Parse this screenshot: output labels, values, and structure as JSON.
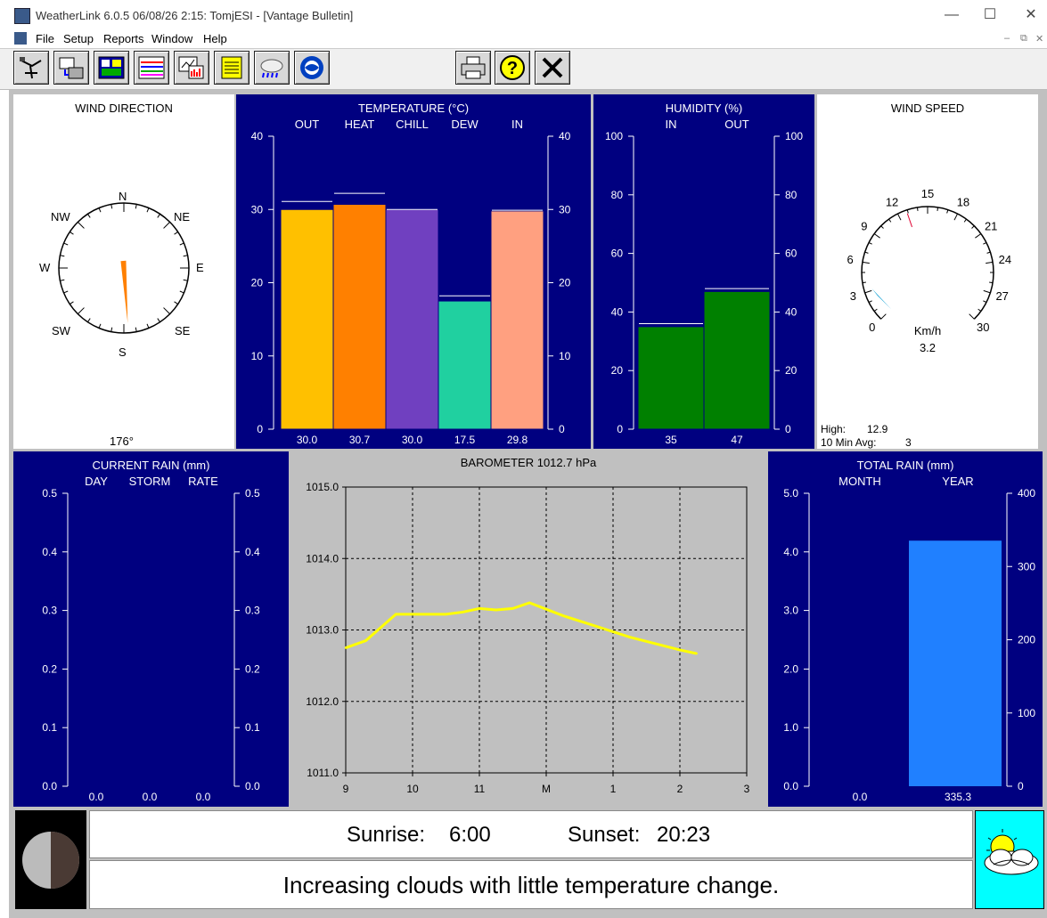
{
  "window": {
    "title": "WeatherLink 6.0.5  06/08/26   2:15: TomjESI - [Vantage Bulletin]",
    "controls": {
      "minimize": "—",
      "maximize": "☐",
      "close": "✕"
    }
  },
  "menu": {
    "items": [
      "File",
      "Setup",
      "Reports",
      "Window",
      "Help"
    ],
    "mdi_controls": [
      "–",
      "⧉",
      "✕"
    ]
  },
  "toolbar": {
    "buttons": [
      "station-icon",
      "download-icon",
      "bulletin-icon",
      "strip-chart-icon",
      "summary-icon",
      "notepad-icon",
      "weather-icon",
      "noaa-icon",
      "print-icon",
      "help-icon",
      "close-icon"
    ]
  },
  "wind_direction": {
    "title": "WIND DIRECTION",
    "labels": {
      "N": "N",
      "NE": "NE",
      "E": "E",
      "SE": "SE",
      "S": "S",
      "SW": "SW",
      "W": "W",
      "NW": "NW"
    },
    "direction_deg": 176,
    "value": "176°"
  },
  "temperature": {
    "title": "TEMPERATURE  (°C)",
    "columns": [
      "OUT",
      "HEAT",
      "CHILL",
      "DEW",
      "IN"
    ],
    "axis_ticks": [
      "40",
      "30",
      "20",
      "10",
      "0"
    ],
    "values": [
      "30.0",
      "30.7",
      "30.0",
      "17.5",
      "29.8"
    ],
    "colors": [
      "#ffc000",
      "#ff8000",
      "#7040c0",
      "#20d0a0",
      "#ffa080"
    ]
  },
  "humidity": {
    "title": "HUMIDITY  (%)",
    "columns": [
      "IN",
      "OUT"
    ],
    "axis_ticks": [
      "100",
      "80",
      "60",
      "40",
      "20",
      "0"
    ],
    "values": [
      "35",
      "47"
    ],
    "color": "#008000"
  },
  "wind_speed": {
    "title": "WIND SPEED",
    "ticks": [
      "0",
      "3",
      "6",
      "9",
      "12",
      "15",
      "18",
      "21",
      "24",
      "27",
      "30"
    ],
    "unit": "Km/h",
    "value": "3.2",
    "speed": 3.2,
    "high_label": "High:",
    "high_value": "12.9",
    "avg_label": "10 Min Avg:",
    "avg_value": "3"
  },
  "current_rain": {
    "title": "CURRENT RAIN  (mm)",
    "columns": [
      "DAY",
      "STORM",
      "RATE"
    ],
    "axis_ticks": [
      "0.5",
      "0.4",
      "0.3",
      "0.2",
      "0.1",
      "0.0"
    ],
    "values": [
      "0.0",
      "0.0",
      "0.0"
    ]
  },
  "barometer": {
    "title": "BAROMETER 1012.7 hPa",
    "y_ticks": [
      "1015.0",
      "1014.0",
      "1013.0",
      "1012.0",
      "1011.0"
    ],
    "x_ticks": [
      "9",
      "10",
      "11",
      "M",
      "1",
      "2",
      "3"
    ],
    "line_color": "#ffff00"
  },
  "chart_data": {
    "type": "line",
    "title": "BAROMETER 1012.7 hPa",
    "xlabel": "",
    "ylabel": "",
    "x": [
      9.0,
      9.3,
      9.75,
      10.0,
      10.5,
      10.75,
      11.0,
      11.25,
      11.5,
      11.75,
      12.25,
      12.75,
      13.25,
      14.0,
      14.25
    ],
    "series": [
      {
        "values": [
          1012.75,
          1012.85,
          1013.22,
          1013.22,
          1013.22,
          1013.25,
          1013.3,
          1013.28,
          1013.3,
          1013.38,
          1013.2,
          1013.05,
          1012.9,
          1012.72,
          1012.67
        ]
      }
    ],
    "xlim": [
      9,
      15
    ],
    "ylim": [
      1011.0,
      1015.0
    ],
    "grid": true
  },
  "total_rain": {
    "title": "TOTAL RAIN  (mm)",
    "columns": [
      "MONTH",
      "YEAR"
    ],
    "left_ticks": [
      "5.0",
      "4.0",
      "3.0",
      "2.0",
      "1.0",
      "0.0"
    ],
    "right_ticks": [
      "400",
      "300",
      "200",
      "100",
      "0"
    ],
    "values": [
      "0.0",
      "335.3"
    ],
    "color": "#2080ff"
  },
  "bottom": {
    "sunrise_label": "Sunrise:",
    "sunrise": "6:00",
    "sunset_label": "Sunset:",
    "sunset": "20:23",
    "forecast": "Increasing clouds with little temperature change."
  }
}
